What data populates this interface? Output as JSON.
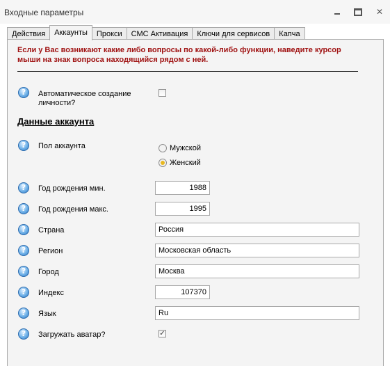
{
  "window": {
    "title": "Входные параметры"
  },
  "tabs": [
    {
      "label": "Действия"
    },
    {
      "label": "Аккаунты",
      "active": true
    },
    {
      "label": "Прокси"
    },
    {
      "label": "СМС Активация"
    },
    {
      "label": "Ключи для сервисов"
    },
    {
      "label": "Капча"
    }
  ],
  "notice": "Если у Вас возникают какие либо вопросы по какой-либо функции, наведите курсор мыши на знак вопроса находящийся рядом с ней.",
  "auto_create": {
    "label": "Автоматическое создание личности?",
    "checked": false
  },
  "section_title": "Данные аккаунта",
  "gender": {
    "label": "Пол аккаунта",
    "options": [
      {
        "label": "Мужской",
        "selected": false
      },
      {
        "label": "Женский",
        "selected": true
      }
    ]
  },
  "fields": {
    "birth_min": {
      "label": "Год рождения мин.",
      "value": "1988"
    },
    "birth_max": {
      "label": "Год рождения макс.",
      "value": "1995"
    },
    "country": {
      "label": "Страна",
      "value": "Россия"
    },
    "region": {
      "label": "Регион",
      "value": "Московская область"
    },
    "city": {
      "label": "Город",
      "value": "Москва"
    },
    "index": {
      "label": "Индекс",
      "value": "107370"
    },
    "language": {
      "label": "Язык",
      "value": "Ru"
    }
  },
  "avatar": {
    "label": "Загружать аватар?",
    "checked": true
  },
  "help_glyph": "?",
  "colors": {
    "notice": "#a01313",
    "help_icon": "#2f78c4",
    "radio_dot": "#e8b820"
  }
}
